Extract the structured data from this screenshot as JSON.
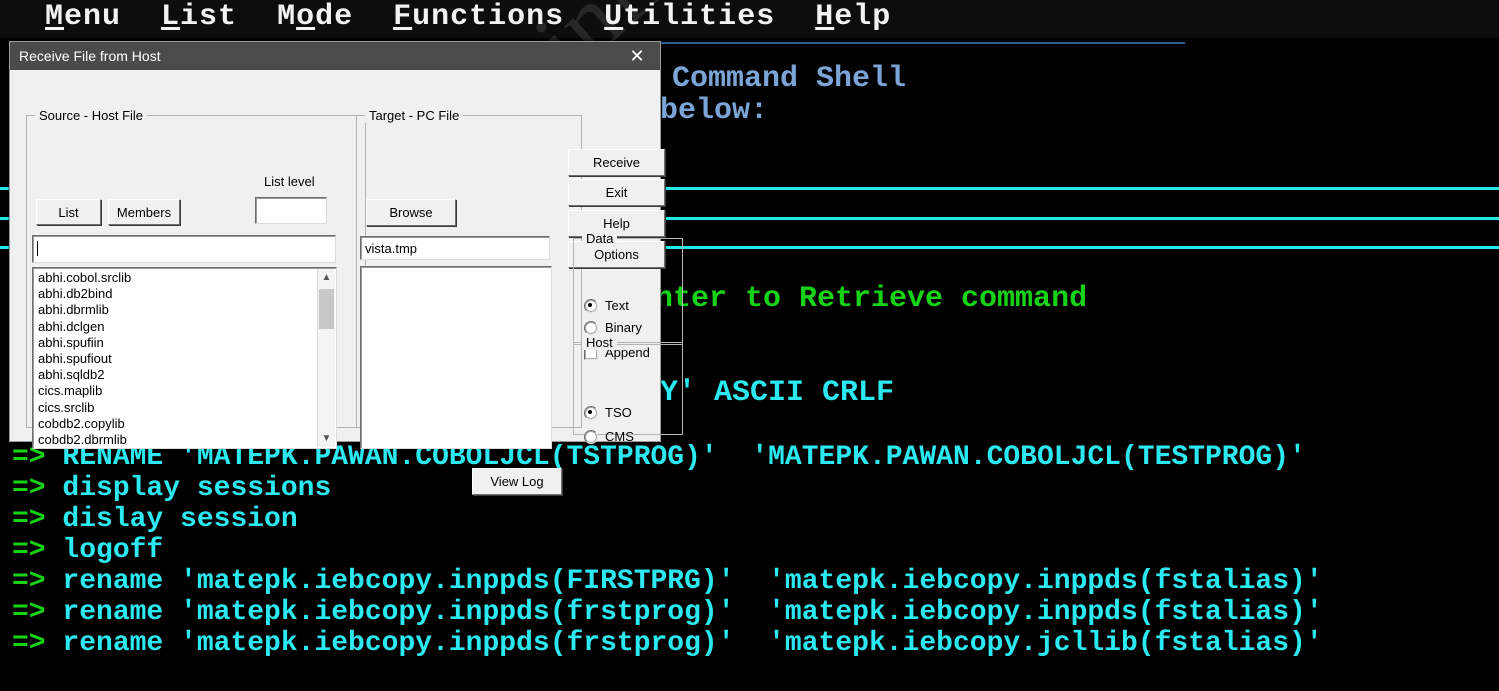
{
  "menubar": {
    "items": [
      {
        "prefix": "",
        "mnemonic": "M",
        "suffix": "enu"
      },
      {
        "prefix": "",
        "mnemonic": "L",
        "suffix": "ist"
      },
      {
        "prefix": "M",
        "mnemonic": "o",
        "suffix": "de"
      },
      {
        "prefix": "",
        "mnemonic": "F",
        "suffix": "unctions"
      },
      {
        "prefix": "",
        "mnemonic": "U",
        "suffix": "tilities"
      },
      {
        "prefix": "",
        "mnemonic": "H",
        "suffix": "elp"
      }
    ],
    "labels": [
      "Menu",
      "List",
      "Mode",
      "Functions",
      "Utilities",
      "Help"
    ]
  },
  "terminal": {
    "colors": {
      "background": "#000000",
      "light_blue": "#7aa5d6",
      "green": "#16d316",
      "cyan": "#2ce8f0",
      "rule_cyan": "#22e8e8",
      "rule_blue": "#2f5d8c"
    },
    "fragment_command_shell": "Command Shell",
    "fragment_below": "below:",
    "fragment_retrieve": "nter to Retrieve command",
    "fragment_ascii": "Y' ASCII CRLF",
    "history": [
      {
        "prompt": "=>",
        "command": "RENAME 'MATEPK.PAWAN.COBOLJCL(TSTPROG)'  'MATEPK.PAWAN.COBOLJCL(TESTPROG)'"
      },
      {
        "prompt": "=>",
        "command": "display sessions"
      },
      {
        "prompt": "=>",
        "command": "dislay session"
      },
      {
        "prompt": "=>",
        "command": "logoff"
      },
      {
        "prompt": "=>",
        "command": "rename 'matepk.iebcopy.inppds(FIRSTPRG)'  'matepk.iebcopy.inppds(fstalias)'"
      },
      {
        "prompt": "=>",
        "command": "rename 'matepk.iebcopy.inppds(frstprog)'  'matepk.iebcopy.inppds(fstalias)'"
      },
      {
        "prompt": "=>",
        "command": "rename 'matepk.iebcopy.inppds(frstprog)'  'matepk.iebcopy.jcllib(fstalias)'"
      }
    ]
  },
  "watermark": {
    "text": "© mainframestechhelp"
  },
  "dialog": {
    "title": "Receive File from Host",
    "close_icon": "close-icon",
    "source_group": {
      "label": "Source - Host File",
      "list_level_label": "List level",
      "list_level_value": "",
      "list_button": "List",
      "members_button": "Members",
      "source_value": "",
      "datasets": [
        "abhi.cobol.srclib",
        "abhi.db2bind",
        "abhi.dbrmlib",
        "abhi.dclgen",
        "abhi.spufiin",
        "abhi.spufiout",
        "abhi.sqldb2",
        "cics.maplib",
        "cics.srclib",
        "cobdb2.copylib",
        "cobdb2.dbrmlib"
      ]
    },
    "target_group": {
      "label": "Target - PC File",
      "browse_button": "Browse",
      "target_value": "vista.tmp",
      "memo_value": ""
    },
    "buttons": {
      "receive": "Receive",
      "exit": "Exit",
      "help": "Help",
      "options": "Options",
      "view_log": "View Log"
    },
    "data_group": {
      "label": "Data",
      "options": [
        {
          "label": "Text",
          "selected": true
        },
        {
          "label": "Binary",
          "selected": false
        }
      ],
      "append": {
        "label": "Append",
        "checked": false
      }
    },
    "host_group": {
      "label": "Host",
      "options": [
        {
          "label": "TSO",
          "selected": true
        },
        {
          "label": "CMS",
          "selected": false
        }
      ]
    },
    "scrollbar": {
      "up_icon": "chevron-up-icon",
      "down_icon": "chevron-down-icon"
    }
  }
}
